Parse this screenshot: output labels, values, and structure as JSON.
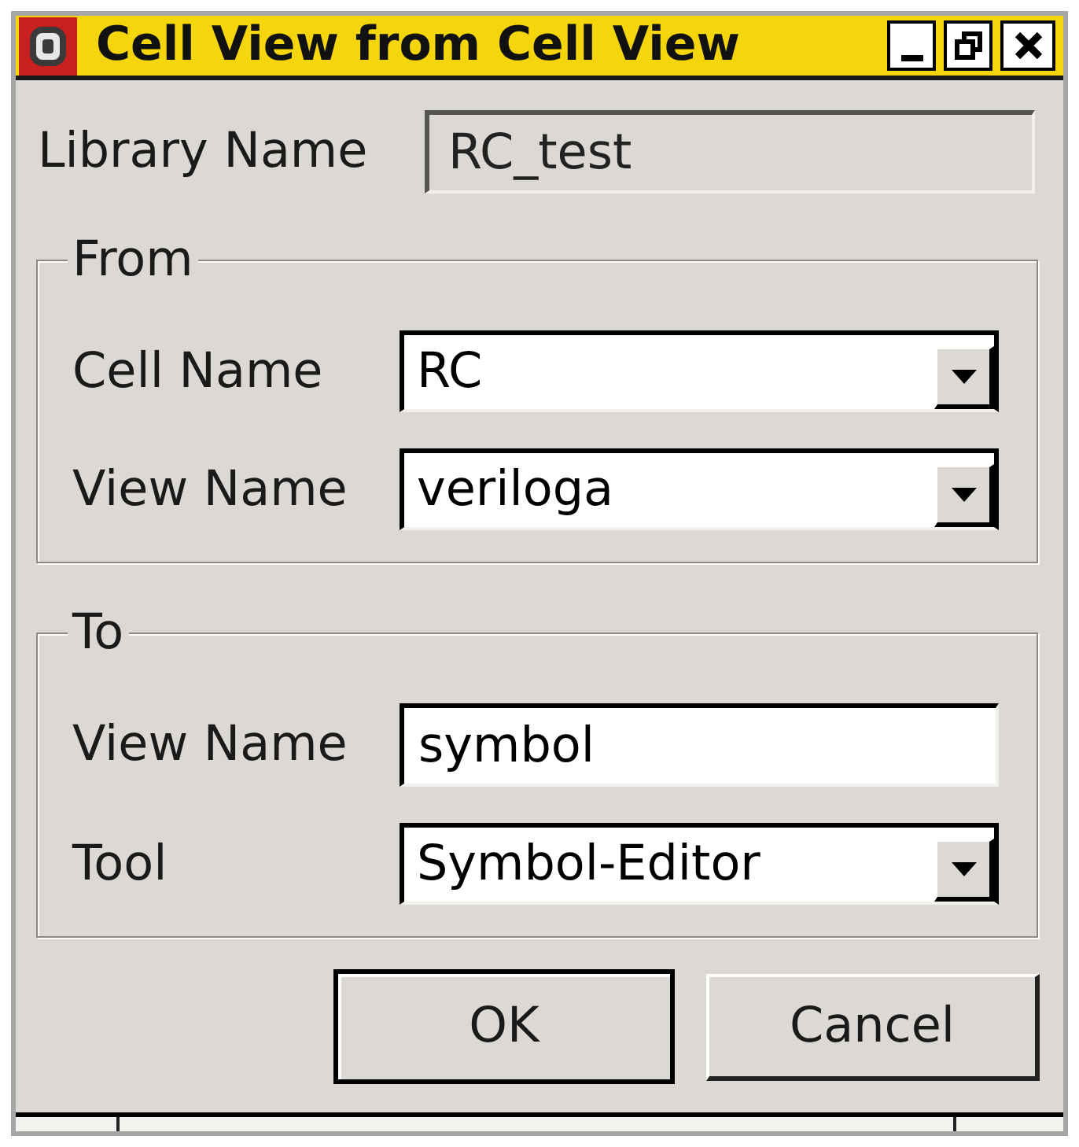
{
  "window": {
    "title": "Cell View from Cell View"
  },
  "library_name": {
    "label": "Library Name",
    "value": "RC_test",
    "disabled": true
  },
  "groups": [
    {
      "title": "From",
      "fields": [
        {
          "kind": "combo",
          "label": "Cell Name",
          "value": "RC"
        },
        {
          "kind": "combo",
          "label": "View Name",
          "value": "veriloga"
        }
      ]
    },
    {
      "title": "To",
      "fields": [
        {
          "kind": "text",
          "label": "View Name",
          "value": "symbol"
        },
        {
          "kind": "combo",
          "label": "Tool",
          "value": "Symbol-Editor"
        }
      ]
    }
  ],
  "buttons": [
    {
      "label": "OK",
      "default": true
    },
    {
      "label": "Cancel",
      "default": false
    }
  ]
}
